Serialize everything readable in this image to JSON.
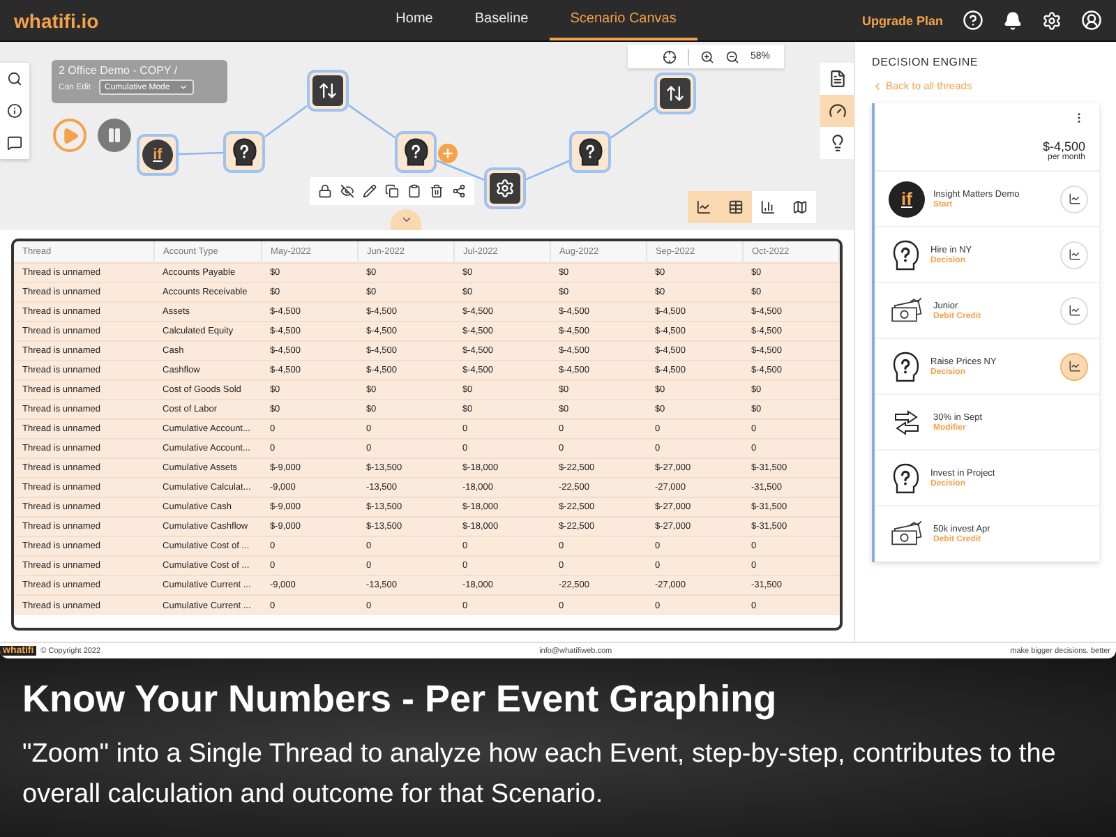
{
  "nav": {
    "logo": "whatifi.io",
    "tabs": [
      {
        "label": "Home",
        "selected": false
      },
      {
        "label": "Baseline",
        "selected": false
      },
      {
        "label": "Scenario Canvas",
        "selected": true
      }
    ],
    "upgrade": "Upgrade Plan"
  },
  "canvas": {
    "title": "2 Office Demo - COPY /",
    "permission": "Can Edit",
    "mode": "Cumulative Mode",
    "zoom": "58%",
    "nodes": [
      {
        "kind": "start",
        "glyph": "if",
        "add_button": false
      },
      {
        "kind": "decision",
        "add_button": false
      },
      {
        "kind": "modifier",
        "add_button": false
      },
      {
        "kind": "decision",
        "add_button": true
      },
      {
        "kind": "debit",
        "add_button": false
      },
      {
        "kind": "decision",
        "add_button": false
      },
      {
        "kind": "modifier",
        "add_button": false
      }
    ],
    "side_tools": [
      {
        "kind": "notes",
        "selected": false
      },
      {
        "kind": "engine",
        "selected": true
      },
      {
        "kind": "ideas",
        "selected": false
      }
    ],
    "views": [
      {
        "kind": "line",
        "selected": true
      },
      {
        "kind": "table",
        "selected": true
      },
      {
        "kind": "bar",
        "selected": false
      },
      {
        "kind": "map",
        "selected": false
      }
    ]
  },
  "table": {
    "columns": [
      "Thread",
      "Account Type",
      "May-2022",
      "Jun-2022",
      "Jul-2022",
      "Aug-2022",
      "Sep-2022",
      "Oct-2022"
    ],
    "rows": [
      [
        "Thread is unnamed",
        "Accounts Payable",
        "$0",
        "$0",
        "$0",
        "$0",
        "$0",
        "$0"
      ],
      [
        "Thread is unnamed",
        "Accounts Receivable",
        "$0",
        "$0",
        "$0",
        "$0",
        "$0",
        "$0"
      ],
      [
        "Thread is unnamed",
        "Assets",
        "$-4,500",
        "$-4,500",
        "$-4,500",
        "$-4,500",
        "$-4,500",
        "$-4,500"
      ],
      [
        "Thread is unnamed",
        "Calculated Equity",
        "$-4,500",
        "$-4,500",
        "$-4,500",
        "$-4,500",
        "$-4,500",
        "$-4,500"
      ],
      [
        "Thread is unnamed",
        "Cash",
        "$-4,500",
        "$-4,500",
        "$-4,500",
        "$-4,500",
        "$-4,500",
        "$-4,500"
      ],
      [
        "Thread is unnamed",
        "Cashflow",
        "$-4,500",
        "$-4,500",
        "$-4,500",
        "$-4,500",
        "$-4,500",
        "$-4,500"
      ],
      [
        "Thread is unnamed",
        "Cost of Goods Sold",
        "$0",
        "$0",
        "$0",
        "$0",
        "$0",
        "$0"
      ],
      [
        "Thread is unnamed",
        "Cost of Labor",
        "$0",
        "$0",
        "$0",
        "$0",
        "$0",
        "$0"
      ],
      [
        "Thread is unnamed",
        "Cumulative Account...",
        "0",
        "0",
        "0",
        "0",
        "0",
        "0"
      ],
      [
        "Thread is unnamed",
        "Cumulative Account...",
        "0",
        "0",
        "0",
        "0",
        "0",
        "0"
      ],
      [
        "Thread is unnamed",
        "Cumulative Assets",
        "$-9,000",
        "$-13,500",
        "$-18,000",
        "$-22,500",
        "$-27,000",
        "$-31,500"
      ],
      [
        "Thread is unnamed",
        "Cumulative Calculat...",
        "-9,000",
        "-13,500",
        "-18,000",
        "-22,500",
        "-27,000",
        "-31,500"
      ],
      [
        "Thread is unnamed",
        "Cumulative Cash",
        "$-9,000",
        "$-13,500",
        "$-18,000",
        "$-22,500",
        "$-27,000",
        "$-31,500"
      ],
      [
        "Thread is unnamed",
        "Cumulative Cashflow",
        "$-9,000",
        "$-13,500",
        "$-18,000",
        "$-22,500",
        "$-27,000",
        "$-31,500"
      ],
      [
        "Thread is unnamed",
        "Cumulative Cost of ...",
        "0",
        "0",
        "0",
        "0",
        "0",
        "0"
      ],
      [
        "Thread is unnamed",
        "Cumulative Cost of ...",
        "0",
        "0",
        "0",
        "0",
        "0",
        "0"
      ],
      [
        "Thread is unnamed",
        "Cumulative Current ...",
        "-9,000",
        "-13,500",
        "-18,000",
        "-22,500",
        "-27,000",
        "-31,500"
      ],
      [
        "Thread is unnamed",
        "Cumulative Current ...",
        "0",
        "0",
        "0",
        "0",
        "0",
        "0"
      ]
    ]
  },
  "panel": {
    "title": "DECISION ENGINE",
    "back": "Back to all threads",
    "amount": "$-4,500",
    "period": "per month",
    "events": [
      {
        "kind": "start",
        "glyph": "if",
        "name": "Insight Matters Demo",
        "type": "Start",
        "graph": true,
        "selected": false
      },
      {
        "kind": "decision",
        "name": "Hire in NY",
        "type": "Decision",
        "graph": true,
        "selected": false
      },
      {
        "kind": "debit",
        "name": "Junior",
        "type": "Debit Credit",
        "graph": true,
        "selected": false
      },
      {
        "kind": "decision",
        "name": "Raise Prices NY",
        "type": "Decision",
        "graph": true,
        "selected": true
      },
      {
        "kind": "modifier",
        "name": "30% in Sept",
        "type": "Modifier",
        "graph": false
      },
      {
        "kind": "decision",
        "name": "Invest in Project",
        "type": "Decision",
        "graph": false
      },
      {
        "kind": "debit",
        "name": "50k invest Apr",
        "type": "Debit Credit",
        "graph": false
      }
    ]
  },
  "footer": {
    "logo": "whatifi",
    "copyright": "© Copyright 2022",
    "email": "info@whatifiweb.com",
    "tagline": "make bigger decisions. better"
  },
  "caption": {
    "title": "Know Your Numbers - Per Event Graphing",
    "body": "\"Zoom\" into a Single Thread to analyze how each Event, step-by-step, contributes to the overall calculation and outcome for that Scenario."
  }
}
